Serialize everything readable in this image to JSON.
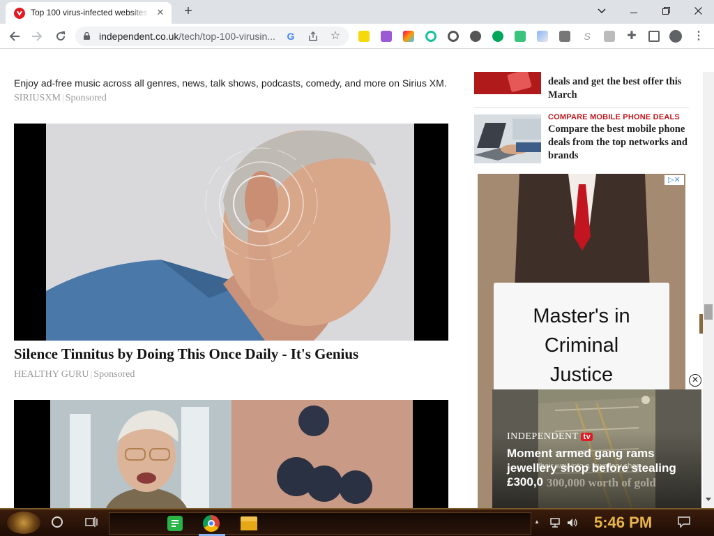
{
  "browser": {
    "tab": {
      "title": "Top 100 virus-infected websites"
    },
    "address_bar": {
      "domain": "independent.co.uk",
      "path": "/tech/top-100-virusin..."
    }
  },
  "content": {
    "promo": {
      "text": "Enjoy ad-free music across all genres, news, talk shows, podcasts, comedy, and more on Sirius XM.",
      "source": "SIRIUSXM",
      "sponsored": "Sponsored"
    },
    "story1": {
      "headline": "Silence Tinnitus by Doing This Once Daily - It's Genius",
      "source": "HEALTHY GURU",
      "sponsored": "Sponsored"
    },
    "sidebar": {
      "item1": {
        "text": "deals and get the best offer this March"
      },
      "item2": {
        "category": "COMPARE MOBILE PHONE DEALS",
        "text": "Compare the best mobile phone deals from the top networks and brands"
      },
      "ad": {
        "line1": "Master's in",
        "line2": "Criminal",
        "line3": "Justice"
      }
    },
    "video": {
      "brand": "INDEPENDENT",
      "brand_tv": "tv",
      "headline": "Moment armed gang rams jewellery shop before stealing £300,0",
      "overlay": "their way into a jewellery shop",
      "overlay2": "300,000 worth of gold"
    }
  },
  "taskbar": {
    "time": "5:46 PM"
  },
  "colors": {
    "accent": "#e21a22",
    "taskbar": "#2a140a",
    "clock": "#e9b54a"
  }
}
